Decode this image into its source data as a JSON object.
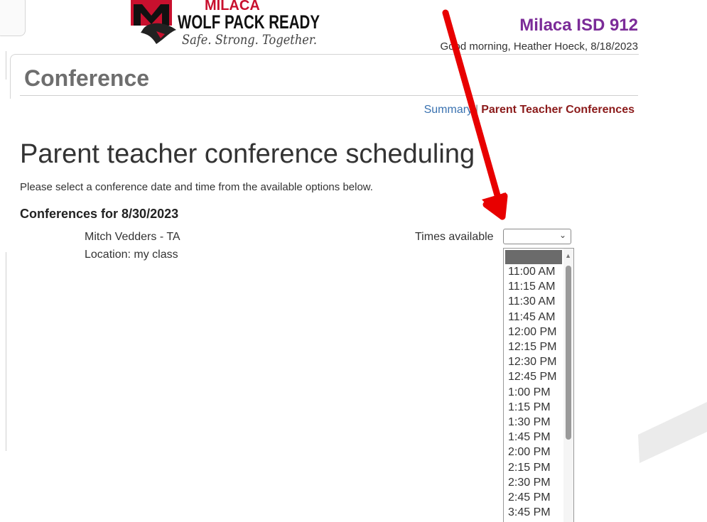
{
  "logo": {
    "top_text": "MILACA",
    "main_text": "WOLF PACK READY",
    "tagline": "Safe. Strong. Together."
  },
  "header": {
    "district": "Milaca ISD 912",
    "greeting": "Good morning, Heather Hoeck, 8/18/2023"
  },
  "card": {
    "title": "Conference"
  },
  "nav": {
    "summary": "Summary",
    "separator": "|",
    "active": "Parent Teacher Conferences"
  },
  "main": {
    "heading": "Parent teacher conference scheduling",
    "instructions": "Please select a conference date and time from the available options below.",
    "section_title": "Conferences for 8/30/2023",
    "teacher": "Mitch Vedders - TA",
    "location": "Location: my class",
    "times_label": "Times available",
    "times_selected": "",
    "time_options": [
      "11:00 AM",
      "11:15 AM",
      "11:30 AM",
      "11:45 AM",
      "12:00 PM",
      "12:15 PM",
      "12:30 PM",
      "12:45 PM",
      "1:00 PM",
      "1:15 PM",
      "1:30 PM",
      "1:45 PM",
      "2:00 PM",
      "2:15 PM",
      "2:30 PM",
      "2:45 PM",
      "3:45 PM"
    ]
  },
  "colors": {
    "district": "#7b2b98",
    "active_nav": "#8b1a1a",
    "link": "#3a72b0",
    "annotation_arrow": "#e80000",
    "logo_red": "#c8102e"
  },
  "icons": {
    "select_chevron": "chevron-down-icon",
    "scroll_up": "scroll-up-icon",
    "annotation": "red-arrow-icon"
  }
}
